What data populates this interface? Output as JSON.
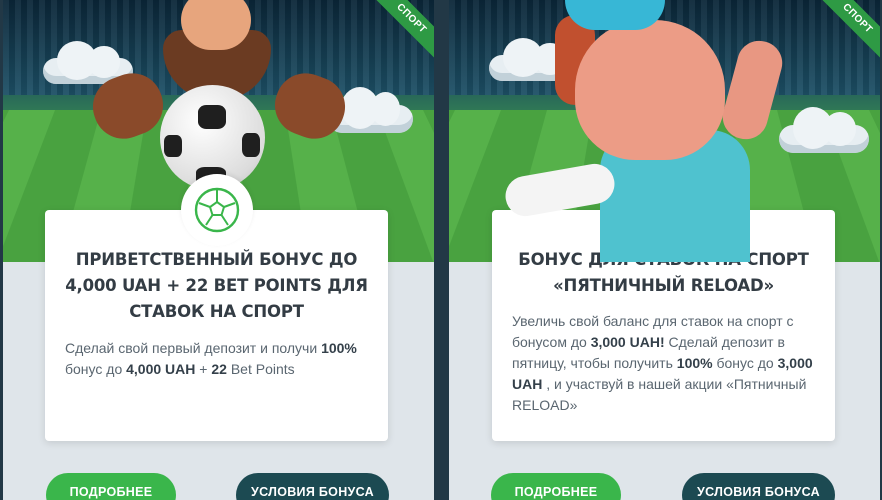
{
  "promos": [
    {
      "ribbon": "СПОРТ",
      "icon": "soccer-ball-icon",
      "title": "ПРИВЕТСТВЕННЫЙ БОНУС ДО 4,000 UAH + 22 BET POINTS ДЛЯ СТАВОК НА СПОРТ",
      "desc": {
        "t1": "Сделай свой первый депозит и получи ",
        "b1": "100%",
        "t2": " бонус до ",
        "b2": "4,000 UAH",
        "t3": " + ",
        "b3": "22",
        "t4": " Bet Points"
      },
      "more_label": "ПОДРОБНЕЕ",
      "terms_label": "УСЛОВИЯ БОНУСА"
    },
    {
      "ribbon": "СПОРТ",
      "icon": "soccer-ball-icon",
      "title": "БОНУС ДЛЯ СТАВОК НА СПОРТ «ПЯТНИЧНЫЙ RELOAD»",
      "desc": {
        "t1": "Увеличь свой баланс для ставок на спорт с бонусом до ",
        "b1": "3,000 UAH!",
        "t2": " Сделай депозит в пятницу, чтобы получить ",
        "b2": "100%",
        "t3": " бонус до ",
        "b3": "3,000 UAH",
        "t4": " , и участвуй в нашей акции «Пятничный RELOAD»"
      },
      "more_label": "ПОДРОБНЕЕ",
      "terms_label": "УСЛОВИЯ БОНУСА"
    }
  ],
  "colors": {
    "accent_green": "#3ab64b",
    "dark_button": "#1c4a52",
    "ribbon_green": "#2e9a44"
  }
}
